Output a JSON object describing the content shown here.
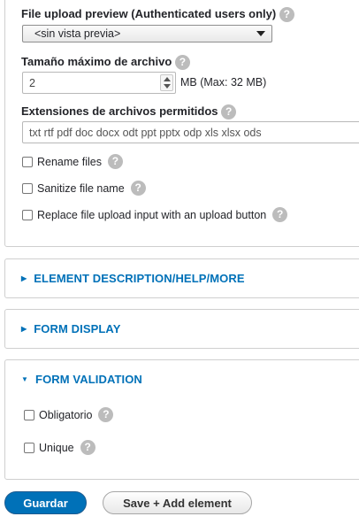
{
  "file_upload_preview": {
    "label": "File upload preview (Authenticated users only)",
    "select_value": "<sin vista previa>"
  },
  "max_size": {
    "label": "Tamaño máximo de archivo",
    "value": "2",
    "suffix": "MB (Max: 32 MB)"
  },
  "extensions": {
    "label": "Extensiones de archivos permitidos",
    "value": "txt rtf pdf doc docx odt ppt pptx odp xls xlsx ods"
  },
  "checkboxes": [
    {
      "label": "Rename files"
    },
    {
      "label": "Sanitize file name"
    },
    {
      "label": "Replace file upload input with an upload button"
    }
  ],
  "sections": {
    "element_description": "ELEMENT DESCRIPTION/HELP/MORE",
    "form_display": "FORM DISPLAY",
    "form_validation": "FORM VALIDATION"
  },
  "validation": {
    "required_label": "Obligatorio",
    "unique_label": "Unique"
  },
  "buttons": {
    "save": "Guardar",
    "save_add": "Save + Add element"
  },
  "help_glyph": "?",
  "colors": {
    "primary_button": "#0071b8",
    "link": "#0071b8"
  }
}
